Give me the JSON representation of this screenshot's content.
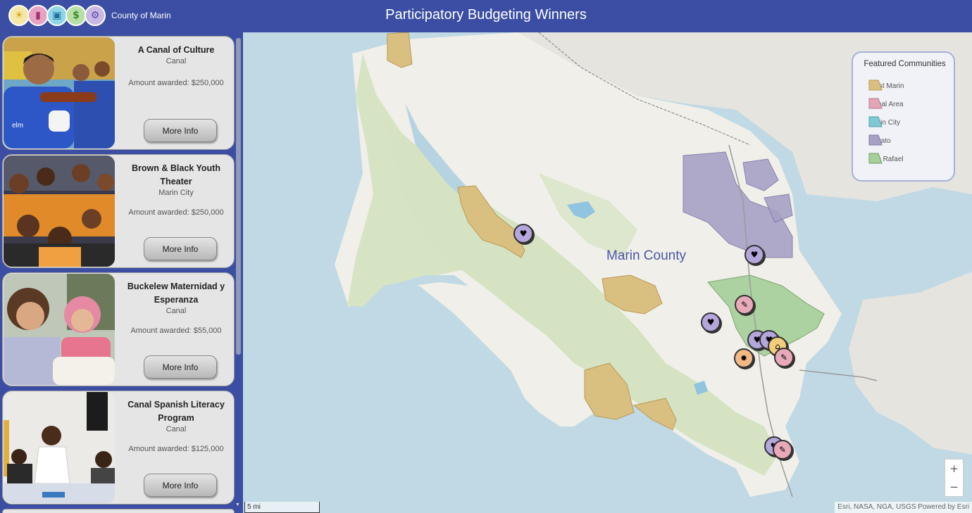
{
  "header": {
    "org_name": "County of Marin",
    "title": "Participatory Budgeting Winners",
    "logos": [
      {
        "icon": "lightbulb-icon",
        "glyph": "☀",
        "bg": "#f5e7a8"
      },
      {
        "icon": "document-icon",
        "glyph": "▮",
        "bg": "#e8a2c4"
      },
      {
        "icon": "printer-icon",
        "glyph": "▣",
        "bg": "#8fd6e8"
      },
      {
        "icon": "dollar-icon",
        "glyph": "$",
        "bg": "#b8e0a6"
      },
      {
        "icon": "gears-icon",
        "glyph": "⚙",
        "bg": "#c7b8e6"
      }
    ]
  },
  "cards": [
    {
      "title": "A Canal of Culture",
      "community": "Canal",
      "amount": "Amount awarded: $250,000",
      "button": "More Info"
    },
    {
      "title": "Brown & Black Youth Theater",
      "community": "Marin City",
      "amount": "Amount awarded: $250,000",
      "button": "More Info"
    },
    {
      "title": "Buckelew Maternidad y Esperanza",
      "community": "Canal",
      "amount": "Amount awarded: $55,000",
      "button": "More Info"
    },
    {
      "title": "Canal Spanish Literacy Program",
      "community": "Canal",
      "amount": "Amount awarded: $125,000",
      "button": "More Info"
    }
  ],
  "map": {
    "county_label": "Marin County",
    "scale_label": "5 mi",
    "attribution": "Esri, NASA, NGA, USGS   Powered by Esri",
    "zoom_in": "+",
    "zoom_out": "−"
  },
  "legend": {
    "title": "Featured Communities",
    "items": [
      {
        "label": "West Marin",
        "color": "#d9bf80"
      },
      {
        "label": "Canal Area",
        "color": "#e3a6b6"
      },
      {
        "label": "Marin City",
        "color": "#7ec9d3"
      },
      {
        "label": "Novato",
        "color": "#a7a1c6"
      },
      {
        "label": "San Rafael",
        "color": "#a6cf9a"
      }
    ]
  },
  "markers": [
    {
      "type": "heart",
      "color": "#b5a6dc"
    },
    {
      "type": "heart",
      "color": "#b5a6dc"
    },
    {
      "type": "paint",
      "color": "#e8a9b8"
    },
    {
      "type": "heart",
      "color": "#b5a6dc"
    },
    {
      "type": "heart",
      "color": "#b5a6dc"
    },
    {
      "type": "home",
      "color": "#f3cd7a"
    },
    {
      "type": "fire",
      "color": "#f3b985"
    },
    {
      "type": "heart",
      "color": "#b5a6dc"
    },
    {
      "type": "paint",
      "color": "#e8a9b8"
    }
  ]
}
